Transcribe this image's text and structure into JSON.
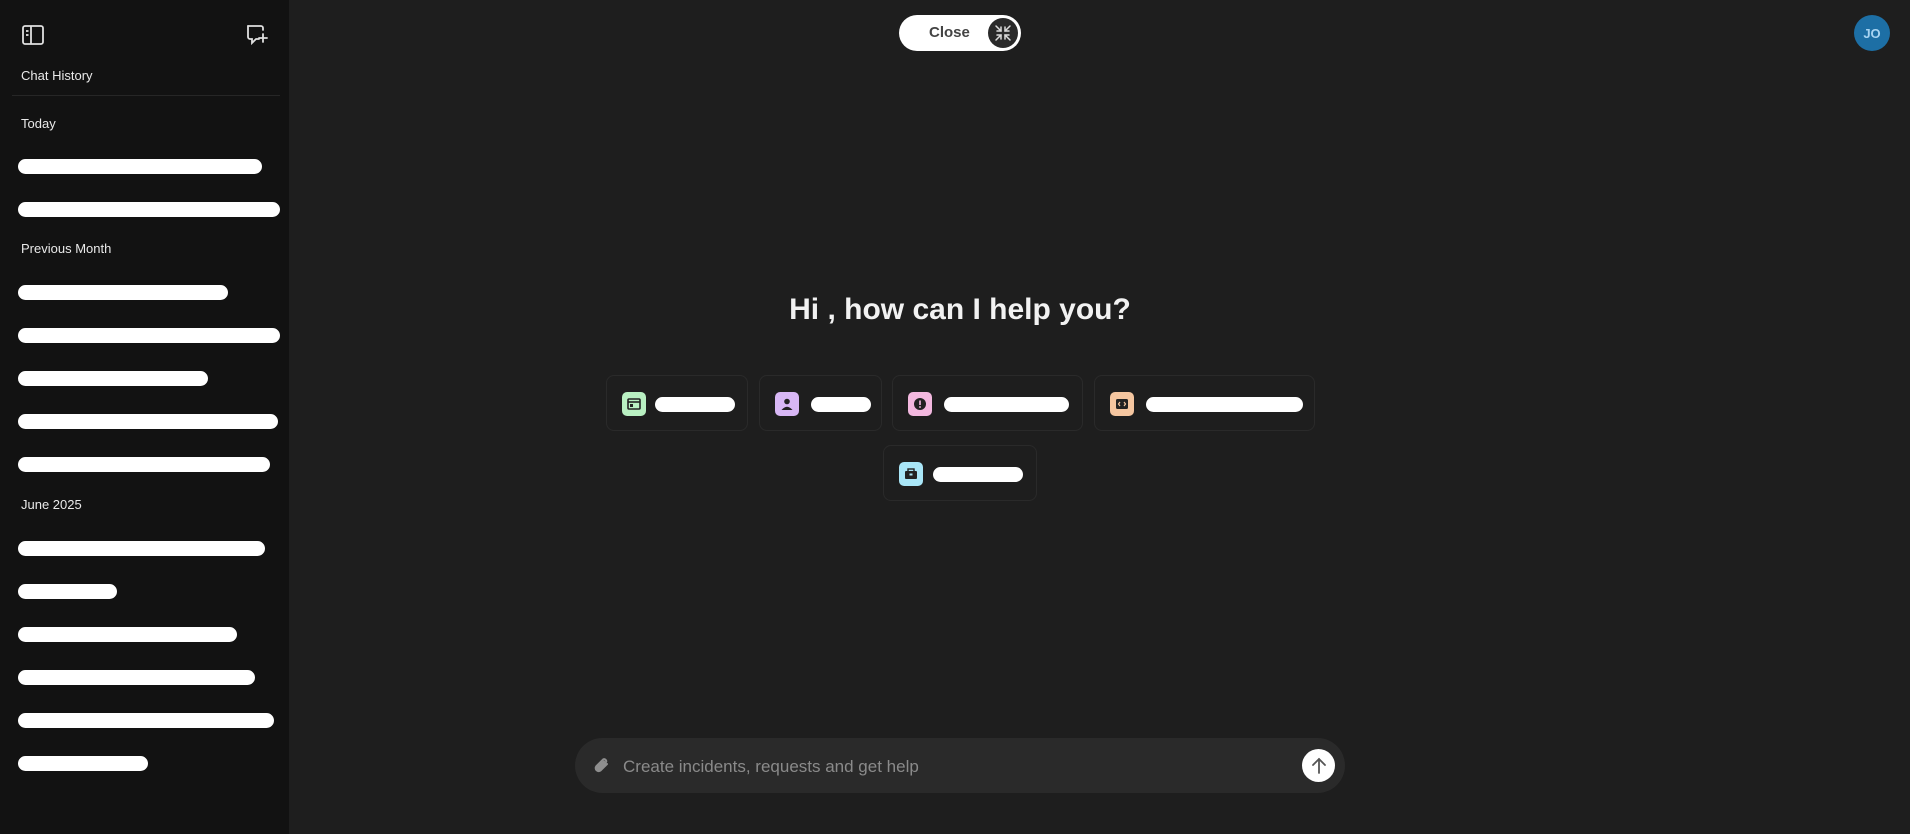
{
  "sidebar": {
    "toggle_icon": "sidebar-panel-icon",
    "new_chat_icon": "new-chat-icon",
    "title": "Chat History",
    "sections": [
      {
        "label": "Today"
      },
      {
        "label": "Previous Month"
      },
      {
        "label": "June 2025"
      }
    ]
  },
  "header": {
    "close_label": "Close",
    "close_icon": "collapse-arrows-icon",
    "avatar_initials": "JO",
    "avatar_color": "#1d6fa5"
  },
  "main": {
    "greeting": "Hi , how can I help you?"
  },
  "suggestions": [
    {
      "icon": "window-icon",
      "color": "#b9f0c2"
    },
    {
      "icon": "user-icon",
      "color": "#d8b7f5"
    },
    {
      "icon": "alert-icon",
      "color": "#f3b8df"
    },
    {
      "icon": "code-icon",
      "color": "#f5c6a0"
    },
    {
      "icon": "box-icon",
      "color": "#a9e6f7"
    }
  ],
  "composer": {
    "placeholder": "Create incidents, requests and get help",
    "attach_icon": "paperclip-icon",
    "send_icon": "send-arrow-icon"
  }
}
